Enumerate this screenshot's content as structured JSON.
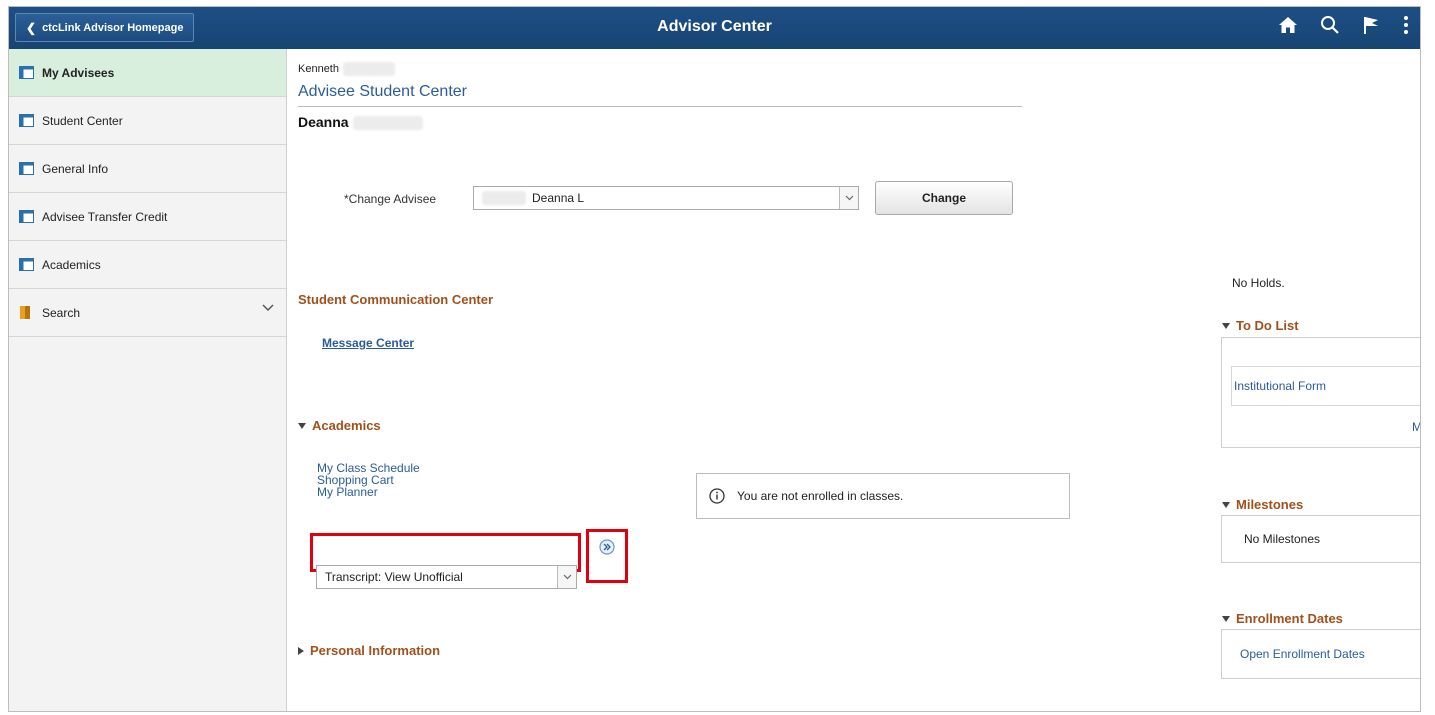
{
  "banner": {
    "back_label": "ctcLink Advisor Homepage",
    "title": "Advisor Center",
    "icons": [
      "home-icon",
      "search-icon",
      "flag-icon",
      "more-vertical-icon"
    ]
  },
  "sidebar": {
    "items": [
      {
        "label": "My Advisees",
        "icon": "page-icon",
        "active": true
      },
      {
        "label": "Student Center",
        "icon": "page-icon"
      },
      {
        "label": "General Info",
        "icon": "page-icon"
      },
      {
        "label": "Advisee Transfer Credit",
        "icon": "page-icon"
      },
      {
        "label": "Academics",
        "icon": "page-icon"
      },
      {
        "label": "Search",
        "icon": "folder-icon",
        "expandable": true
      }
    ]
  },
  "main": {
    "advisor_name": "Kenneth",
    "page_title": "Advisee Student Center",
    "student_name": "Deanna",
    "change_advisee": {
      "label": "*Change Advisee",
      "selected": "Deanna L",
      "button": "Change"
    },
    "communication": {
      "title": "Student Communication Center",
      "link": "Message Center"
    },
    "academics": {
      "title": "Academics",
      "links": [
        "My Class Schedule",
        "Shopping Cart",
        "My Planner"
      ],
      "notice": "You are not enrolled in classes.",
      "dropdown_selected": "Transcript: View Unofficial"
    },
    "personal_info": {
      "title": "Personal Information"
    }
  },
  "right": {
    "holds": "No Holds.",
    "todo": {
      "title": "To Do List",
      "item": "Institutional Form",
      "more": "Mc"
    },
    "milestones": {
      "title": "Milestones",
      "text": "No Milestones"
    },
    "enrollment": {
      "title": "Enrollment Dates",
      "link": "Open Enrollment Dates"
    }
  },
  "colors": {
    "banner": "#1d4f86",
    "active_nav": "#d8efdd",
    "section_title": "#a2501b",
    "link": "#2a5c9b",
    "highlight": "#e0000f"
  }
}
